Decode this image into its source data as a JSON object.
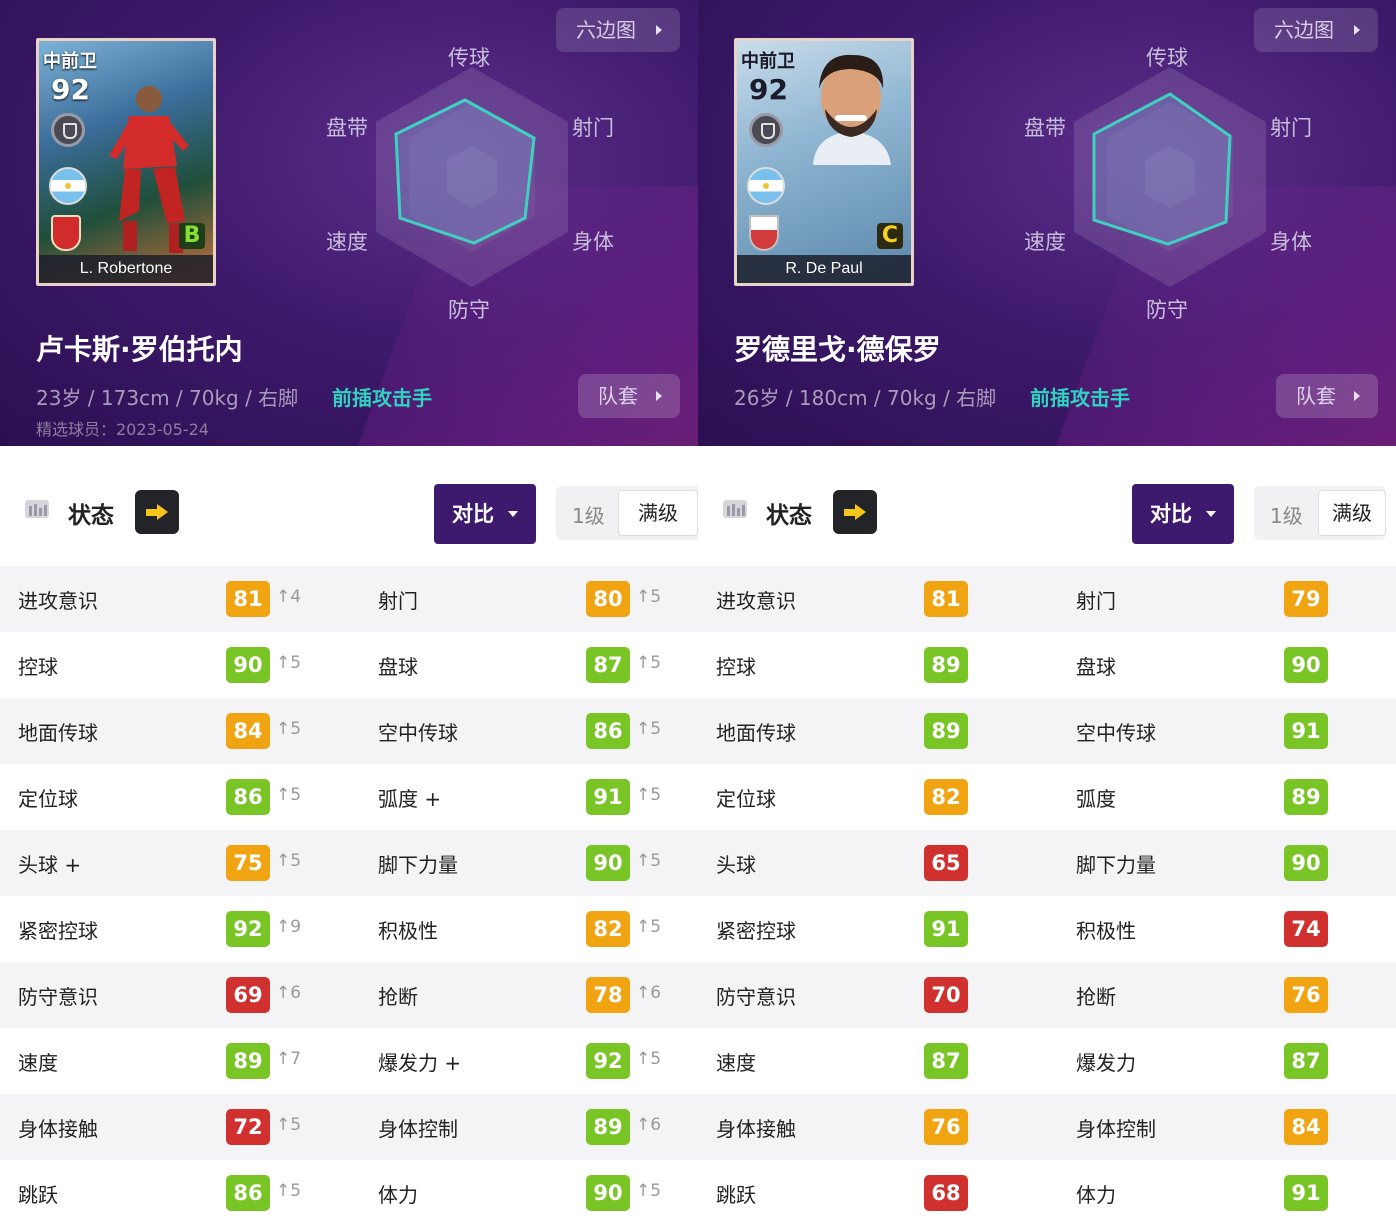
{
  "colors": {
    "green": "#79c526",
    "orange": "#f0a411",
    "red": "#d0312f",
    "accent": "#30d3c0",
    "purple": "#3d1a6e"
  },
  "players": [
    {
      "card": {
        "position": "中前卫",
        "rating": "92",
        "name": "L. Robertone",
        "grade": "B"
      },
      "hex_button": "六边图",
      "radar_labels": {
        "top": "传球",
        "top_left": "盘带",
        "top_right": "射门",
        "bottom_left": "速度",
        "bottom_right": "身体",
        "bottom": "防守"
      },
      "full_name": "卢卡斯·罗伯托内",
      "info": "23岁 / 173cm / 70kg / 右脚",
      "role": "前插攻击手",
      "date": "精选球员：2023-05-24",
      "kit_button": "队套",
      "state_title": "状态",
      "compare_button": "对比",
      "level_1": "1级",
      "level_max": "满级",
      "stats": [
        {
          "left": {
            "name": "进攻意识",
            "value": "81",
            "color": "orange",
            "inc": "↑4"
          },
          "right": {
            "name": "射门",
            "value": "80",
            "color": "orange",
            "inc": "↑5"
          }
        },
        {
          "left": {
            "name": "控球",
            "value": "90",
            "color": "green",
            "inc": "↑5"
          },
          "right": {
            "name": "盘球",
            "value": "87",
            "color": "green",
            "inc": "↑5"
          }
        },
        {
          "left": {
            "name": "地面传球",
            "value": "84",
            "color": "orange",
            "inc": "↑5"
          },
          "right": {
            "name": "空中传球",
            "value": "86",
            "color": "green",
            "inc": "↑5"
          }
        },
        {
          "left": {
            "name": "定位球",
            "value": "86",
            "color": "green",
            "inc": "↑5"
          },
          "right": {
            "name": "弧度 +",
            "value": "91",
            "color": "green",
            "inc": "↑5"
          }
        },
        {
          "left": {
            "name": "头球 +",
            "value": "75",
            "color": "orange",
            "inc": "↑5"
          },
          "right": {
            "name": "脚下力量",
            "value": "90",
            "color": "green",
            "inc": "↑5"
          }
        },
        {
          "left": {
            "name": "紧密控球",
            "value": "92",
            "color": "green",
            "inc": "↑9"
          },
          "right": {
            "name": "积极性",
            "value": "82",
            "color": "orange",
            "inc": "↑5"
          }
        },
        {
          "left": {
            "name": "防守意识",
            "value": "69",
            "color": "red",
            "inc": "↑6"
          },
          "right": {
            "name": "抢断",
            "value": "78",
            "color": "orange",
            "inc": "↑6"
          }
        },
        {
          "left": {
            "name": "速度",
            "value": "89",
            "color": "green",
            "inc": "↑7"
          },
          "right": {
            "name": "爆发力 +",
            "value": "92",
            "color": "green",
            "inc": "↑5"
          }
        },
        {
          "left": {
            "name": "身体接触",
            "value": "72",
            "color": "red",
            "inc": "↑5"
          },
          "right": {
            "name": "身体控制",
            "value": "89",
            "color": "green",
            "inc": "↑6"
          }
        },
        {
          "left": {
            "name": "跳跃",
            "value": "86",
            "color": "green",
            "inc": "↑5"
          },
          "right": {
            "name": "体力",
            "value": "90",
            "color": "green",
            "inc": "↑5"
          }
        }
      ]
    },
    {
      "card": {
        "position": "中前卫",
        "rating": "92",
        "name": "R. De Paul",
        "grade": "C"
      },
      "hex_button": "六边图",
      "radar_labels": {
        "top": "传球",
        "top_left": "盘带",
        "top_right": "射门",
        "bottom_left": "速度",
        "bottom_right": "身体",
        "bottom": "防守"
      },
      "full_name": "罗德里戈·德保罗",
      "info": "26岁 / 180cm / 70kg / 右脚",
      "role": "前插攻击手",
      "kit_button": "队套",
      "state_title": "状态",
      "compare_button": "对比",
      "level_1": "1级",
      "level_max": "满级",
      "stats": [
        {
          "left": {
            "name": "进攻意识",
            "value": "81",
            "color": "orange"
          },
          "right": {
            "name": "射门",
            "value": "79",
            "color": "orange"
          }
        },
        {
          "left": {
            "name": "控球",
            "value": "89",
            "color": "green"
          },
          "right": {
            "name": "盘球",
            "value": "90",
            "color": "green"
          }
        },
        {
          "left": {
            "name": "地面传球",
            "value": "89",
            "color": "green"
          },
          "right": {
            "name": "空中传球",
            "value": "91",
            "color": "green"
          }
        },
        {
          "left": {
            "name": "定位球",
            "value": "82",
            "color": "orange"
          },
          "right": {
            "name": "弧度",
            "value": "89",
            "color": "green"
          }
        },
        {
          "left": {
            "name": "头球",
            "value": "65",
            "color": "red"
          },
          "right": {
            "name": "脚下力量",
            "value": "90",
            "color": "green"
          }
        },
        {
          "left": {
            "name": "紧密控球",
            "value": "91",
            "color": "green"
          },
          "right": {
            "name": "积极性",
            "value": "74",
            "color": "red"
          }
        },
        {
          "left": {
            "name": "防守意识",
            "value": "70",
            "color": "red"
          },
          "right": {
            "name": "抢断",
            "value": "76",
            "color": "orange"
          }
        },
        {
          "left": {
            "name": "速度",
            "value": "87",
            "color": "green"
          },
          "right": {
            "name": "爆发力",
            "value": "87",
            "color": "green"
          }
        },
        {
          "left": {
            "name": "身体接触",
            "value": "76",
            "color": "orange"
          },
          "right": {
            "name": "身体控制",
            "value": "84",
            "color": "orange"
          }
        },
        {
          "left": {
            "name": "跳跃",
            "value": "68",
            "color": "red"
          },
          "right": {
            "name": "体力",
            "value": "91",
            "color": "green"
          }
        }
      ]
    }
  ]
}
